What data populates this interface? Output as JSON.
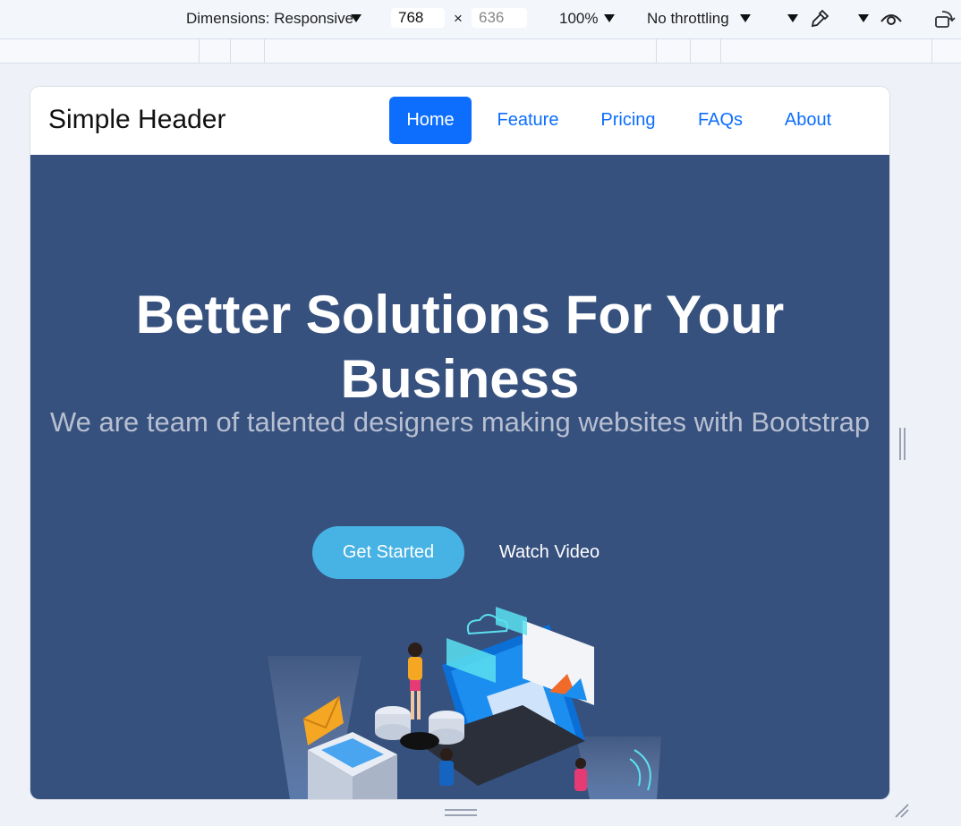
{
  "devtools": {
    "dimensions_label": "Dimensions: Responsive",
    "width_value": "768",
    "height_placeholder": "636",
    "times": "×",
    "zoom": "100%",
    "throttling": "No throttling",
    "icons": [
      "caret-down-icon",
      "eyedropper-icon",
      "eye-icon",
      "rotate-icon"
    ]
  },
  "navbar": {
    "brand": "Simple Header",
    "items": [
      {
        "label": "Home",
        "active": true
      },
      {
        "label": "Feature"
      },
      {
        "label": "Pricing"
      },
      {
        "label": "FAQs"
      },
      {
        "label": "About"
      }
    ],
    "colors": {
      "accent": "#0d6efd"
    }
  },
  "hero": {
    "title": "Better Solutions For Your Business",
    "subtitle": "We are team of talented designers making websites with Bootstrap",
    "primary_button": "Get Started",
    "secondary_button": "Watch Video",
    "colors": {
      "background": "#37517e",
      "button": "#47b2e4"
    }
  }
}
